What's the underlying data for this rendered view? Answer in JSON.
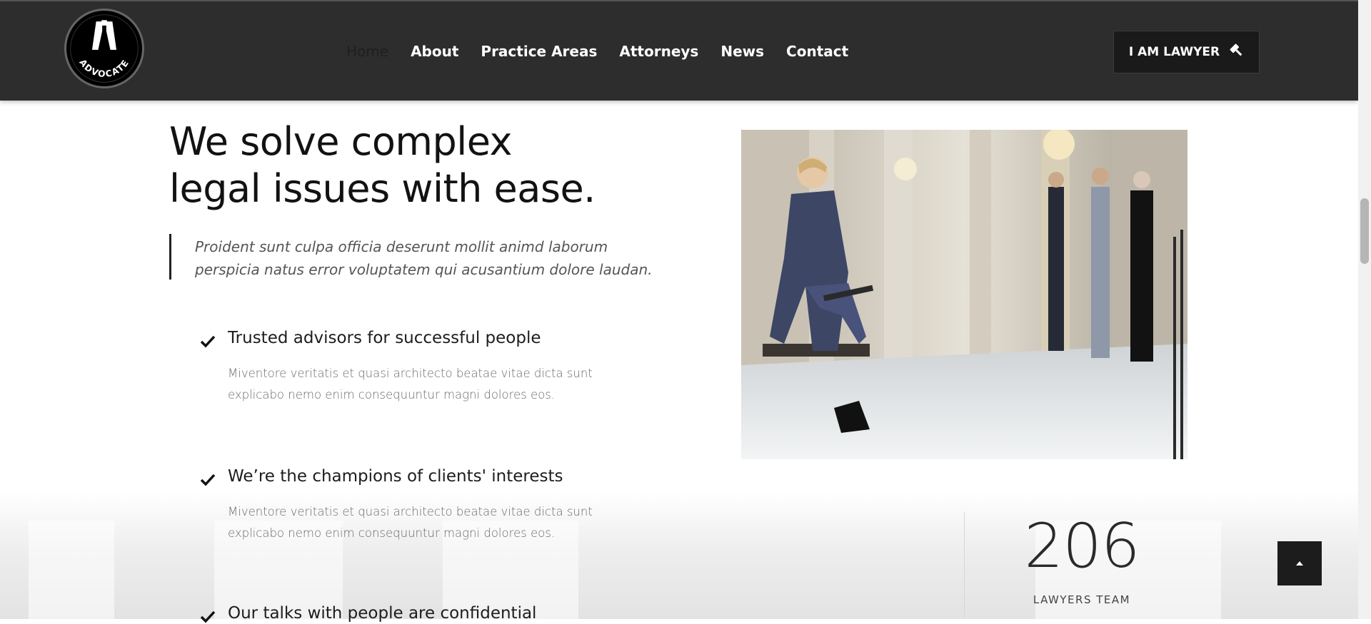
{
  "header": {
    "logo_text": "ADVOCATE",
    "nav": [
      {
        "label": "Home"
      },
      {
        "label": "About"
      },
      {
        "label": "Practice Areas"
      },
      {
        "label": "Attorneys"
      },
      {
        "label": "News"
      },
      {
        "label": "Contact"
      }
    ],
    "cta_label": "I AM LAWYER",
    "cta_icon": "gavel-icon"
  },
  "main": {
    "headline_line1": "We solve complex",
    "headline_line2": "legal issues with ease.",
    "quote": "Proident sunt culpa officia deserunt mollit animd laborum perspicia natus error voluptatem qui acusantium dolore laudan.",
    "features": [
      {
        "title": "Trusted advisors for successful people",
        "desc": "Miventore veritatis et quasi architecto beatae vitae dicta sunt explicabo nemo enim consequuntur magni dolores eos."
      },
      {
        "title": "We’re the champions of clients' interests",
        "desc": "Miventore veritatis et quasi architecto beatae vitae dicta sunt explicabo nemo enim consequuntur magni dolores eos."
      },
      {
        "title": "Our talks with people are confidential",
        "desc": ""
      }
    ]
  },
  "stats": {
    "number": "206",
    "label": "LAWYERS TEAM"
  },
  "colors": {
    "header_bg": "#2e2d2e",
    "button_bg": "#1a1a1a",
    "text_dark": "#121212",
    "text_muted": "#6a6a6a"
  }
}
